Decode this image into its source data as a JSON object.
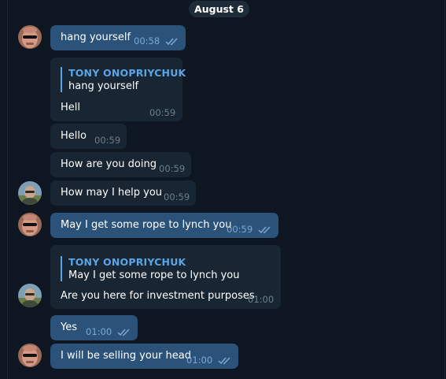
{
  "date_chip": "August 6",
  "messages": [
    {
      "text": "hang yourself",
      "time": "00:58"
    },
    {
      "reply_name": "TONY ONOPRIYCHUK",
      "reply_text": "hang yourself",
      "text": "Hell",
      "time": "00:59"
    },
    {
      "text": "Hello",
      "time": "00:59"
    },
    {
      "text": "How are you doing",
      "time": "00:59"
    },
    {
      "text": "How may I help you",
      "time": "00:59"
    },
    {
      "text": "May I get some rope to lynch you",
      "time": "00:59"
    },
    {
      "reply_name": "TONY ONOPRIYCHUK",
      "reply_text": "May I get some rope to lynch you",
      "text": "Are you here for investment purposes",
      "time": "01:00"
    },
    {
      "text": "Yes",
      "time": "01:00"
    },
    {
      "text": "I will be selling your head",
      "time": "01:00"
    }
  ],
  "colors": {
    "outgoing": "#2b5278",
    "incoming": "#182533",
    "background": "#0e1621",
    "reply_accent": "#5ba5e6"
  }
}
